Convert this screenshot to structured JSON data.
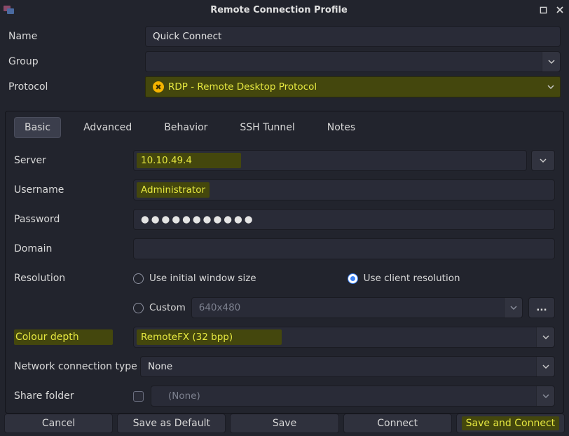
{
  "window": {
    "title": "Remote Connection Profile"
  },
  "top": {
    "name_label": "Name",
    "name_value": "Quick Connect",
    "group_label": "Group",
    "group_value": "",
    "protocol_label": "Protocol",
    "protocol_value": "RDP - Remote Desktop Protocol"
  },
  "tabs": {
    "basic": "Basic",
    "advanced": "Advanced",
    "behavior": "Behavior",
    "ssh": "SSH Tunnel",
    "notes": "Notes",
    "active": "basic"
  },
  "basic": {
    "server_label": "Server",
    "server_value": "10.10.49.4",
    "username_label": "Username",
    "username_value": "Administrator",
    "password_label": "Password",
    "password_value": "●●●●●●●●●●●",
    "domain_label": "Domain",
    "domain_value": "",
    "resolution_label": "Resolution",
    "res_initial": "Use initial window size",
    "res_client": "Use client resolution",
    "res_custom": "Custom",
    "res_custom_value": "640x480",
    "ellipsis": "...",
    "colour_label": "Colour depth",
    "colour_value": "RemoteFX (32 bpp)",
    "net_label": "Network connection type",
    "net_value": "None",
    "share_label": "Share folder",
    "share_value": "(None)"
  },
  "buttons": {
    "cancel": "Cancel",
    "save_default": "Save as Default",
    "save": "Save",
    "connect": "Connect",
    "save_connect": "Save and Connect"
  }
}
